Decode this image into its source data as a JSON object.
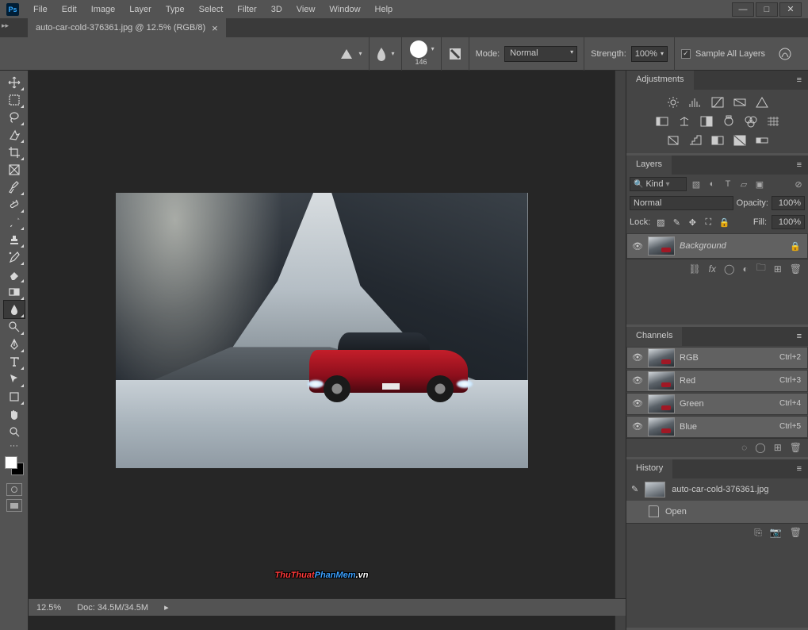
{
  "menu": {
    "file": "File",
    "edit": "Edit",
    "image": "Image",
    "layer": "Layer",
    "type": "Type",
    "select": "Select",
    "filter": "Filter",
    "threeD": "3D",
    "view": "View",
    "window": "Window",
    "help": "Help"
  },
  "document": {
    "tab_title": "auto-car-cold-376361.jpg @ 12.5% (RGB/8)",
    "filename": "auto-car-cold-376361.jpg"
  },
  "option_bar": {
    "brush_size": "146",
    "mode_label": "Mode:",
    "mode_value": "Normal",
    "strength_label": "Strength:",
    "strength_value": "100%",
    "sample_all_label": "Sample All Layers",
    "sample_all_checked": "✓"
  },
  "panels": {
    "adjustments": {
      "title": "Adjustments"
    },
    "layers": {
      "title": "Layers",
      "kind_label": "Kind",
      "blend_mode": "Normal",
      "opacity_label": "Opacity:",
      "opacity_value": "100%",
      "lock_label": "Lock:",
      "fill_label": "Fill:",
      "fill_value": "100%",
      "layer_name": "Background"
    },
    "channels": {
      "title": "Channels",
      "rows": [
        {
          "name": "RGB",
          "shortcut": "Ctrl+2"
        },
        {
          "name": "Red",
          "shortcut": "Ctrl+3"
        },
        {
          "name": "Green",
          "shortcut": "Ctrl+4"
        },
        {
          "name": "Blue",
          "shortcut": "Ctrl+5"
        }
      ]
    },
    "history": {
      "title": "History",
      "snapshot": "auto-car-cold-376361.jpg",
      "state": "Open"
    }
  },
  "statusbar": {
    "zoom": "12.5%",
    "doc": "Doc: 34.5M/34.5M"
  },
  "watermark": {
    "a": "ThuThuat",
    "b": "PhanMem",
    "c": ".vn"
  },
  "app_logo": "Ps"
}
